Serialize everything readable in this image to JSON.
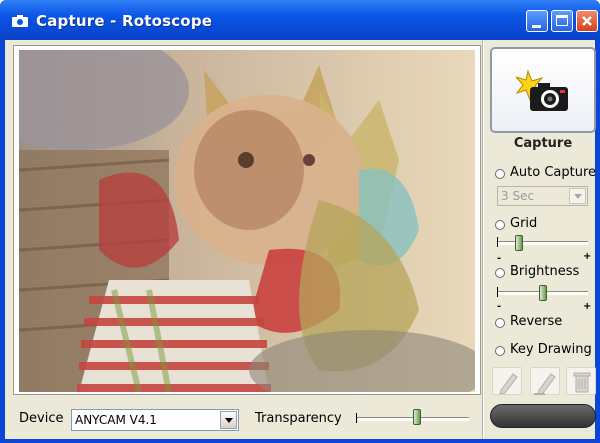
{
  "window": {
    "title": "Capture - Rotoscope"
  },
  "capture": {
    "label": "Capture",
    "icon": "camera-flash-icon"
  },
  "options": {
    "auto_capture": "Auto Capture",
    "interval_value": "3 Sec",
    "grid": "Grid",
    "brightness": "Brightness",
    "reverse": "Reverse",
    "key_drawing": "Key Drawing",
    "minus": "-",
    "plus": "+"
  },
  "levels": {
    "grid": 0.15,
    "brightness": 0.5,
    "transparency": 0.5
  },
  "bottom": {
    "device_label": "Device",
    "device_value": "ANYCAM V4.1",
    "transparency_label": "Transparency"
  },
  "tools": [
    "pen-icon",
    "eraser-pen-icon",
    "trash-icon"
  ],
  "colors": {
    "titlebar": "#0b55e6",
    "panel_bg": "#ece9d8"
  }
}
